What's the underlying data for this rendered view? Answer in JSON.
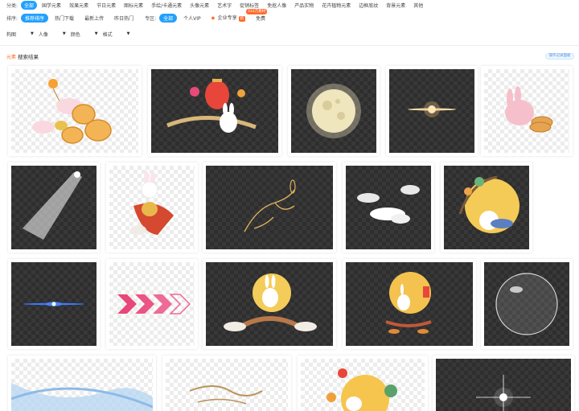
{
  "categories": {
    "label": "分类:",
    "items": [
      "全部",
      "国学元素",
      "效果元素",
      "节日元素",
      "图标元素",
      "手绘/卡通元素",
      "头像元素",
      "艺术字",
      "促销标签",
      "免抠人像",
      "产品实物",
      "花卉植物元素",
      "边框底纹",
      "背景元素",
      "其他"
    ],
    "badge": "333万素材"
  },
  "sort": {
    "label": "排序:",
    "items": [
      "推荐排序",
      "热门下载",
      "最新上传",
      "昨日热门"
    ],
    "zone_label": "专区:",
    "zones": [
      "全部",
      "个人VIP",
      "企业专享",
      "免费"
    ],
    "enterprise_tag": "新"
  },
  "filters": [
    {
      "label": "构图"
    },
    {
      "label": "人像"
    },
    {
      "label": "颜色"
    },
    {
      "label": "格式"
    }
  ],
  "results": {
    "tag": "元素",
    "title": "搜索结果",
    "button": "操作记录面板"
  },
  "colors": {
    "accent": "#22a0ff",
    "orange": "#ff6a2b",
    "checker_dark": "#2e2e2e"
  },
  "thumbnails": [
    {
      "name": "rabbit-mooncakes-lantern"
    },
    {
      "name": "rabbit-red-lantern"
    },
    {
      "name": "full-moon"
    },
    {
      "name": "lens-flare-gold"
    },
    {
      "name": "pink-rabbit-mooncake"
    },
    {
      "name": "light-beam"
    },
    {
      "name": "rabbit-holding-mooncake"
    },
    {
      "name": "line-art-rabbit-gold"
    },
    {
      "name": "clouds-white"
    },
    {
      "name": "rabbit-moon-tree"
    },
    {
      "name": "blue-lens-flare"
    },
    {
      "name": "pink-arrows"
    },
    {
      "name": "rabbit-bridge-moon"
    },
    {
      "name": "rabbit-moon-boat"
    },
    {
      "name": "transparent-bubble"
    },
    {
      "name": "blue-ribbon"
    },
    {
      "name": "gold-swirl-lines"
    },
    {
      "name": "rabbit-flowers-moon"
    },
    {
      "name": "starlight-sparkle"
    }
  ]
}
